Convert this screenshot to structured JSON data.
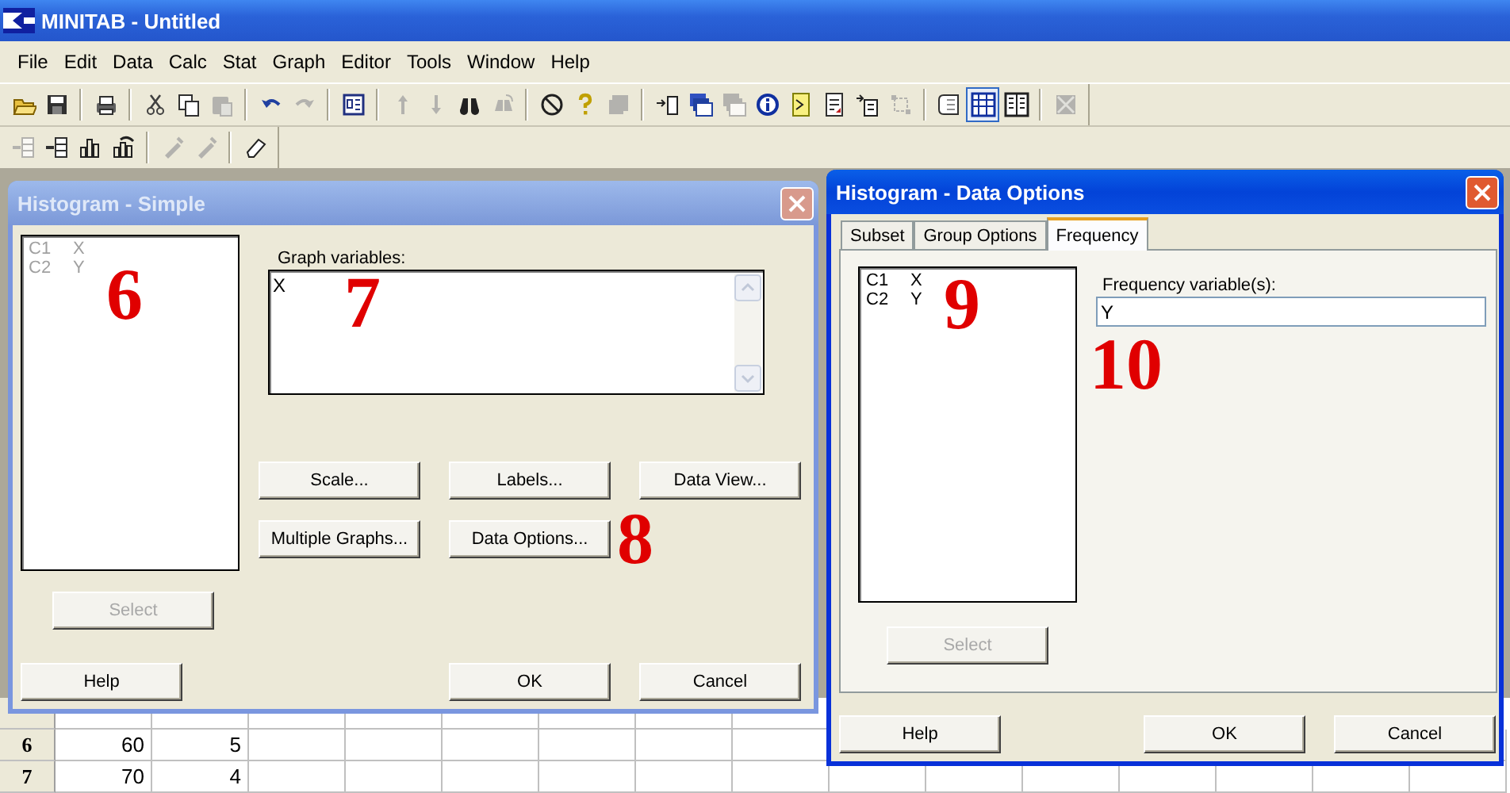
{
  "app": {
    "title": "MINITAB - Untitled"
  },
  "menu": [
    {
      "label": "File"
    },
    {
      "label": "Edit"
    },
    {
      "label": "Data"
    },
    {
      "label": "Calc"
    },
    {
      "label": "Stat"
    },
    {
      "label": "Graph"
    },
    {
      "label": "Editor"
    },
    {
      "label": "Tools"
    },
    {
      "label": "Window"
    },
    {
      "label": "Help"
    }
  ],
  "toolbar_1": [
    [
      {
        "kind": "folder",
        "disabled": false,
        "pressed": false
      },
      {
        "kind": "save",
        "disabled": false,
        "pressed": false
      }
    ],
    [
      {
        "kind": "printer",
        "disabled": false,
        "pressed": false
      }
    ],
    [
      {
        "kind": "scissors",
        "disabled": false,
        "pressed": false
      },
      {
        "kind": "copy",
        "disabled": false,
        "pressed": false
      },
      {
        "kind": "clipboard",
        "disabled": true,
        "pressed": false
      }
    ],
    [
      {
        "kind": "undo",
        "disabled": false,
        "pressed": false
      },
      {
        "kind": "redo",
        "disabled": true,
        "pressed": false
      }
    ],
    [
      {
        "kind": "window",
        "disabled": false,
        "pressed": false
      }
    ],
    [
      {
        "kind": "up",
        "disabled": true,
        "pressed": false
      },
      {
        "kind": "down",
        "disabled": true,
        "pressed": false
      },
      {
        "kind": "binoculars",
        "disabled": false,
        "pressed": false
      },
      {
        "kind": "replace",
        "disabled": true,
        "pressed": false
      }
    ],
    [
      {
        "kind": "nosign",
        "disabled": false,
        "pressed": false
      },
      {
        "kind": "question",
        "disabled": false,
        "pressed": false
      },
      {
        "kind": "stack",
        "disabled": true,
        "pressed": false
      }
    ],
    [
      {
        "kind": "import",
        "disabled": false,
        "pressed": false
      },
      {
        "kind": "windows",
        "disabled": false,
        "pressed": false
      },
      {
        "kind": "windows",
        "disabled": true,
        "pressed": false
      },
      {
        "kind": "info",
        "disabled": false,
        "pressed": false
      },
      {
        "kind": "command",
        "disabled": false,
        "pressed": false
      },
      {
        "kind": "document",
        "disabled": false,
        "pressed": false
      },
      {
        "kind": "insert",
        "disabled": false,
        "pressed": false
      },
      {
        "kind": "frame",
        "disabled": true,
        "pressed": false
      }
    ],
    [
      {
        "kind": "scroll",
        "disabled": false,
        "pressed": false
      },
      {
        "kind": "grid",
        "disabled": false,
        "pressed": true
      },
      {
        "kind": "columns",
        "disabled": false,
        "pressed": false
      }
    ],
    [
      {
        "kind": "closeall",
        "disabled": true,
        "pressed": false
      }
    ]
  ],
  "toolbar_2": [
    [
      {
        "kind": "rowdel",
        "disabled": true,
        "pressed": false
      },
      {
        "kind": "rowadd",
        "disabled": false,
        "pressed": false
      },
      {
        "kind": "bars",
        "disabled": false,
        "pressed": false
      },
      {
        "kind": "barsup",
        "disabled": false,
        "pressed": false
      }
    ],
    [
      {
        "kind": "brush",
        "disabled": true,
        "pressed": false
      },
      {
        "kind": "brush",
        "disabled": true,
        "pressed": false
      }
    ],
    [
      {
        "kind": "eraser",
        "disabled": false,
        "pressed": false
      }
    ]
  ],
  "worksheet": {
    "rows": [
      {
        "header": "6",
        "cells": [
          "60",
          "5"
        ]
      },
      {
        "header": "7",
        "cells": [
          "70",
          "4"
        ]
      }
    ]
  },
  "histogram_dialog": {
    "title": "Histogram - Simple",
    "active": false,
    "variable_list": {
      "disabled": true,
      "items": [
        {
          "column": "C1",
          "name": "X"
        },
        {
          "column": "C2",
          "name": "Y"
        }
      ]
    },
    "graph_variables": {
      "label": "Graph variables:",
      "value": "X"
    },
    "option_buttons": [
      {
        "label": "Scale...",
        "disabled": false
      },
      {
        "label": "Labels...",
        "disabled": false
      },
      {
        "label": "Data View...",
        "disabled": false
      },
      {
        "label": "Multiple Graphs...",
        "disabled": false
      },
      {
        "label": "Data Options...",
        "disabled": false
      }
    ],
    "select_button": {
      "label": "Select",
      "disabled": true
    },
    "footer_buttons": [
      {
        "label": "Help",
        "disabled": false
      },
      {
        "label": "OK",
        "disabled": false
      },
      {
        "label": "Cancel",
        "disabled": false
      }
    ],
    "annotations": [
      "6",
      "7",
      "8"
    ]
  },
  "data_options_dialog": {
    "title": "Histogram - Data Options",
    "active": true,
    "tabs": [
      {
        "label": "Subset",
        "selected": false
      },
      {
        "label": "Group Options",
        "selected": false
      },
      {
        "label": "Frequency",
        "selected": true
      }
    ],
    "variable_list": {
      "disabled": false,
      "items": [
        {
          "column": "C1",
          "name": "X"
        },
        {
          "column": "C2",
          "name": "Y"
        }
      ]
    },
    "frequency_variables": {
      "label": "Frequency variable(s):",
      "value": "Y"
    },
    "select_button": {
      "label": "Select",
      "disabled": true
    },
    "footer_buttons": [
      {
        "label": "Help",
        "disabled": false
      },
      {
        "label": "OK",
        "disabled": false
      },
      {
        "label": "Cancel",
        "disabled": false
      }
    ],
    "annotations": [
      "9",
      "10"
    ]
  }
}
